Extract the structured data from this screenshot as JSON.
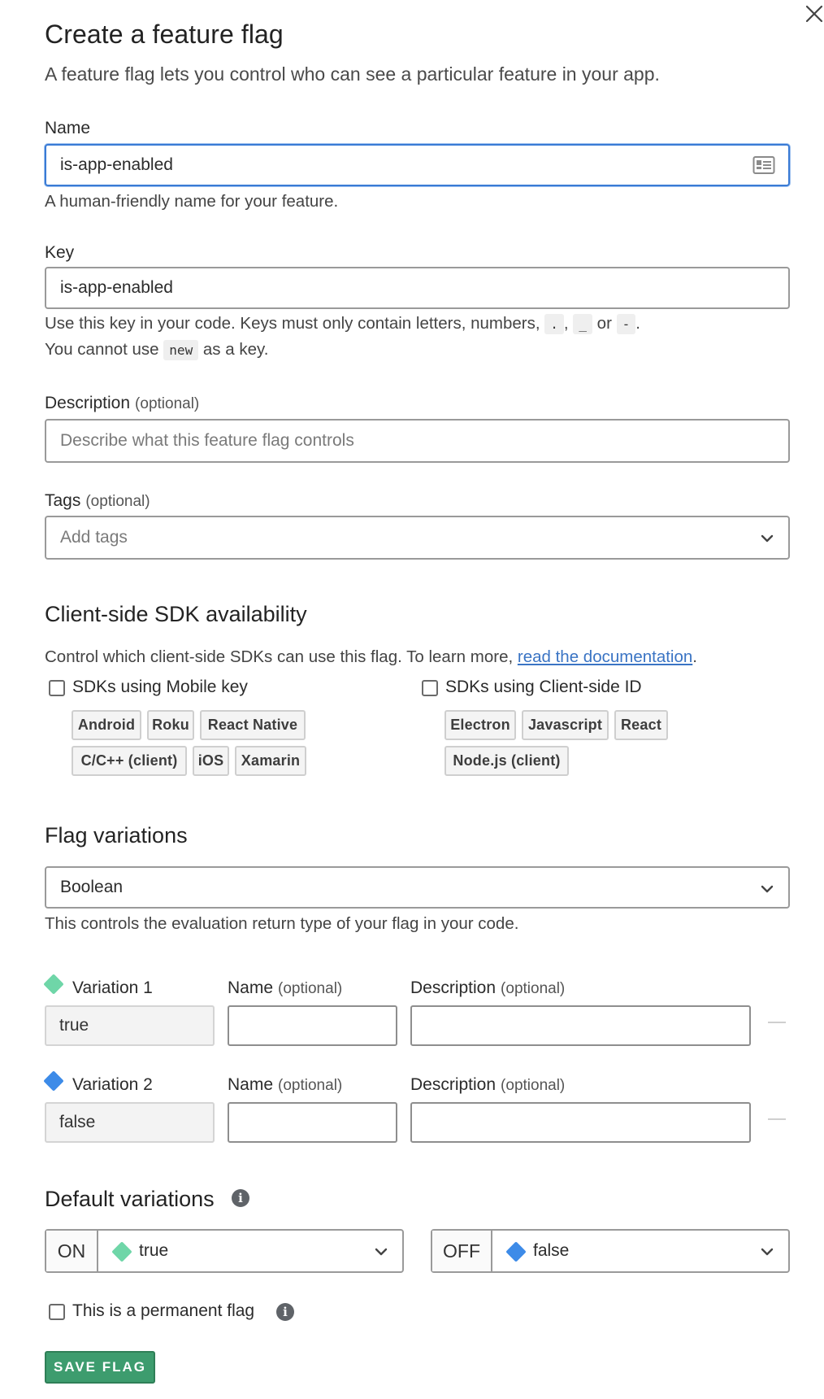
{
  "header": {
    "title": "Create a feature flag",
    "subtitle": "A feature flag lets you control who can see a particular feature in your app."
  },
  "name_field": {
    "label": "Name",
    "value": "is-app-enabled",
    "help": "A human-friendly name for your feature."
  },
  "key_field": {
    "label": "Key",
    "value": "is-app-enabled",
    "help_part1": "Use this key in your code. Keys must only contain letters, numbers,",
    "char_dot": ".",
    "sep_comma": ",",
    "char_underscore": "_",
    "word_or": "or",
    "char_dash": "-",
    "end_period": ".",
    "help_line2_before": "You cannot use",
    "help_line2_code": "new",
    "help_line2_after": "as a key."
  },
  "description_field": {
    "label": "Description",
    "optional": "(optional)",
    "placeholder": "Describe what this feature flag controls"
  },
  "tags_field": {
    "label": "Tags",
    "optional": "(optional)",
    "placeholder": "Add tags"
  },
  "client_sdk": {
    "heading": "Client-side SDK availability",
    "desc_before": "Control which client-side SDKs can use this flag. To learn more,",
    "desc_link": "read the documentation",
    "desc_after": ".",
    "mobile": {
      "label": "SDKs using Mobile key",
      "checked": false,
      "chips": [
        "Android",
        "Roku",
        "React Native",
        "C/C++ (client)",
        "iOS",
        "Xamarin"
      ]
    },
    "client_id": {
      "label": "SDKs using Client-side ID",
      "checked": false,
      "chips": [
        "Electron",
        "Javascript",
        "React",
        "Node.js (client)"
      ]
    }
  },
  "flag_variations": {
    "heading": "Flag variations",
    "type_value": "Boolean",
    "help": "This controls the evaluation return type of your flag in your code.",
    "name_label": "Name",
    "desc_label": "Description",
    "optional": "(optional)",
    "variations": [
      {
        "label": "Variation 1",
        "value": "true",
        "color": "#6fd6a8"
      },
      {
        "label": "Variation 2",
        "value": "false",
        "color": "#3d8be8"
      }
    ]
  },
  "default_variations": {
    "heading": "Default variations",
    "on_label": "ON",
    "on_value": "true",
    "off_label": "OFF",
    "off_value": "false"
  },
  "permanent": {
    "label": "This is a permanent flag",
    "checked": false
  },
  "save_button": "SAVE FLAG",
  "icons": {
    "close": "close-icon",
    "card": "contact-card-icon",
    "chevron": "chevron-down-icon",
    "info": "info-icon"
  }
}
